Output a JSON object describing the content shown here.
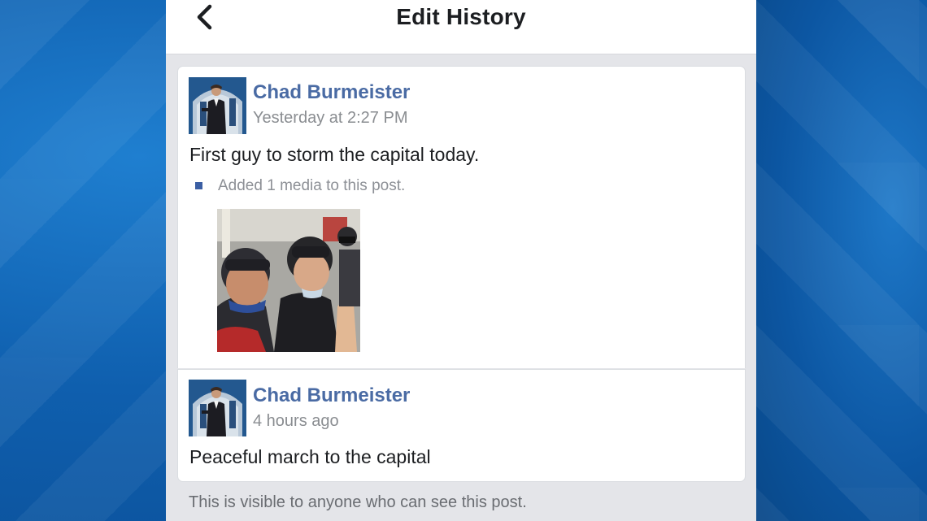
{
  "header": {
    "title": "Edit History",
    "back_icon": "chevron-left-icon"
  },
  "revisions": [
    {
      "author": "Chad Burmeister",
      "timestamp": "Yesterday at 2:27 PM",
      "text": "First guy to storm the capital today.",
      "media_note": "Added 1 media to this post."
    },
    {
      "author": "Chad Burmeister",
      "timestamp": "4 hours ago",
      "text": "Peaceful march to the capital"
    }
  ],
  "footer": {
    "note": "This is visible to anyone who can see this post."
  },
  "colors": {
    "author": "#4a6ba4",
    "bullet": "#3b5fa4",
    "background": "#0d5aa6"
  }
}
